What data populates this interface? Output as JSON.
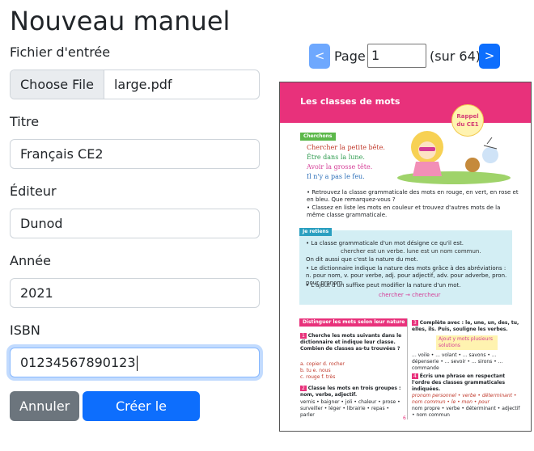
{
  "page": {
    "title": "Nouveau manuel"
  },
  "form": {
    "file": {
      "label": "Fichier d'entrée",
      "button": "Choose File",
      "filename": "large.pdf"
    },
    "titre": {
      "label": "Titre",
      "value": "Français CE2"
    },
    "editeur": {
      "label": "Éditeur",
      "value": "Dunod"
    },
    "annee": {
      "label": "Année",
      "value": "2021"
    },
    "isbn": {
      "label": "ISBN",
      "value": "01234567890123"
    },
    "cancel_label": "Annuler",
    "submit_label": "Créer le manuel"
  },
  "pager": {
    "prev": "<",
    "page_label": "Page",
    "current": "1",
    "total_text": "(sur 64)",
    "next": ">"
  },
  "preview": {
    "header": "Les classes de mots",
    "badge_1": "Rappel",
    "badge_2": "du CE1",
    "tag_cherchons": "Cherchons",
    "line1": "Chercher la petite bête.",
    "line2": "Être dans la lune.",
    "line3": "Avoir la grosse tête.",
    "line4": "Il n'y a pas le feu.",
    "q1": "• Retrouvez la classe grammaticale des mots en rouge, en vert, en rose et en bleu. Que remarquez-vous ?",
    "q2": "• Classez en liste les mots en couleur et trouvez d'autres mots de la même classe grammaticale.",
    "tag_retiens": "Je retiens",
    "r1": "• La classe grammaticale d'un mot désigne ce qu'il est.",
    "r2": "chercher est un verbe.   lune est un nom commun.",
    "r3": "On dit aussi que c'est la nature du mot.",
    "r4": "• Le dictionnaire indique la nature des mots grâce à des abréviations : n. pour nom, v. pour verbe, adj. pour adjectif, adv. pour adverbe, pron. pour pronom.",
    "r5": "• L'ajout d'un suffixe peut modifier la nature d'un mot.",
    "r6": "chercher → chercheur",
    "tag_distinguer": "Distinguer les mots selon leur nature",
    "e1": "Cherche les mots suivants dans le dictionnaire et indique leur classe. Combien de classes as-tu trouvées ?",
    "e1a": "a. copier   d. rocher",
    "e1b": "b. tu   e. nous",
    "e1c": "c. rouge   f. très",
    "e2": "Classe les mots en trois groupes : nom, verbe, adjectif.",
    "e2a": "vernis • baigner • joli • chaleur • prose • surveiller • léger • librairie • repas • parler",
    "e3": "Complète avec : le, une, un, des, tu, elles, ils. Puis, souligne les verbes.",
    "e3a": "Ajout y mots plusieurs solutions",
    "e3b": "... voile • ... volant • ... savons • ... dépenserie • ... sevoir • ... sirons • ... commande",
    "e4": "Écris une phrase en respectant l'ordre des classes grammaticales indiquées.",
    "e4a": "pronom personnel • verbe • déterminant • nom commun • le • mon • pour",
    "e4b": "nom propre • verbe • déterminant • adjectif • nom commun",
    "page_num": "6"
  },
  "colors": {
    "primary": "#0d6efd",
    "primary_disabled": "#6ea8fe",
    "secondary": "#6c757d",
    "header_pink": "#e8317b",
    "retiens_blue": "#d3eef4",
    "cherchons_green": "#5cb84a"
  }
}
